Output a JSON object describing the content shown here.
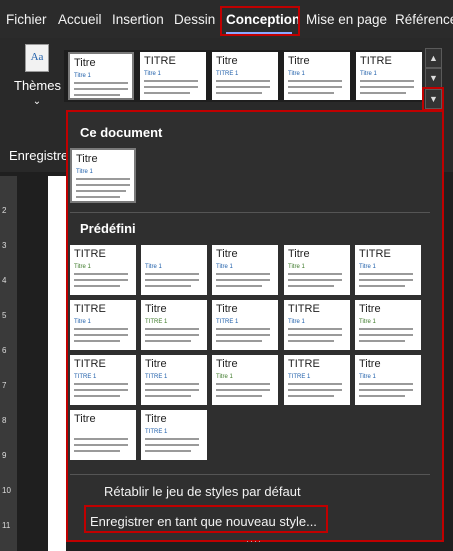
{
  "menu": {
    "tabs": [
      "Fichier",
      "Accueil",
      "Insertion",
      "Dessin",
      "Conception",
      "Mise en page",
      "Référence"
    ],
    "active": "Conception"
  },
  "ribbon": {
    "themes_label": "Thèmes",
    "themes_icon_text": "Aa",
    "enregistrer_label": "Enregistre"
  },
  "gallery_row": [
    {
      "title": "Titre",
      "sub": "Titre 1"
    },
    {
      "title": "TITRE",
      "sub": "Titre 1"
    },
    {
      "title": "Titre",
      "sub": "TITRE 1"
    },
    {
      "title": "Titre",
      "sub": "Titre 1"
    },
    {
      "title": "TITRE",
      "sub": "Titre 1"
    }
  ],
  "panel": {
    "this_document": "Ce document",
    "predefined": "Prédéfini",
    "doc_thumb": {
      "title": "Titre",
      "sub": "Titre 1"
    },
    "reset": "Rétablir le jeu de styles par défaut",
    "save": "Enregistrer en tant que nouveau style...",
    "grip": "····"
  },
  "predefined_thumbs": [
    {
      "title": "TITRE",
      "sub": "Titre 1"
    },
    {
      "title": "",
      "sub": "Titre 1"
    },
    {
      "title": "Titre",
      "sub": "Titre 1"
    },
    {
      "title": "Titre",
      "sub": "Titre 1"
    },
    {
      "title": "TITRE",
      "sub": "Titre 1"
    },
    {
      "title": "TITRE",
      "sub": "Titre 1"
    },
    {
      "title": "Titre",
      "sub": "TITRE 1"
    },
    {
      "title": "Titre",
      "sub": "TITRE 1"
    },
    {
      "title": "TITRE",
      "sub": "Titre 1"
    },
    {
      "title": "Titre",
      "sub": "Titre 1"
    },
    {
      "title": "TITRE",
      "sub": "TITRE 1"
    },
    {
      "title": "Titre",
      "sub": "TITRE 1"
    },
    {
      "title": "Titre",
      "sub": "Titre 1"
    },
    {
      "title": "TITRE",
      "sub": "TITRE 1"
    },
    {
      "title": "Titre",
      "sub": "Titre 1"
    },
    {
      "title": "Titre",
      "sub": ""
    },
    {
      "title": "Titre",
      "sub": "TITRE 1"
    }
  ],
  "colors": {
    "accent_red": "#c00000",
    "title_blue": "#1f5faa",
    "title_green": "#3d7a2a"
  },
  "ruler_numbers": [
    "2",
    "3",
    "4",
    "5",
    "6",
    "7",
    "8",
    "9",
    "10",
    "11"
  ],
  "icons": {
    "up": "chevron-up-icon",
    "down": "chevron-down-icon",
    "more": "more-icon"
  }
}
